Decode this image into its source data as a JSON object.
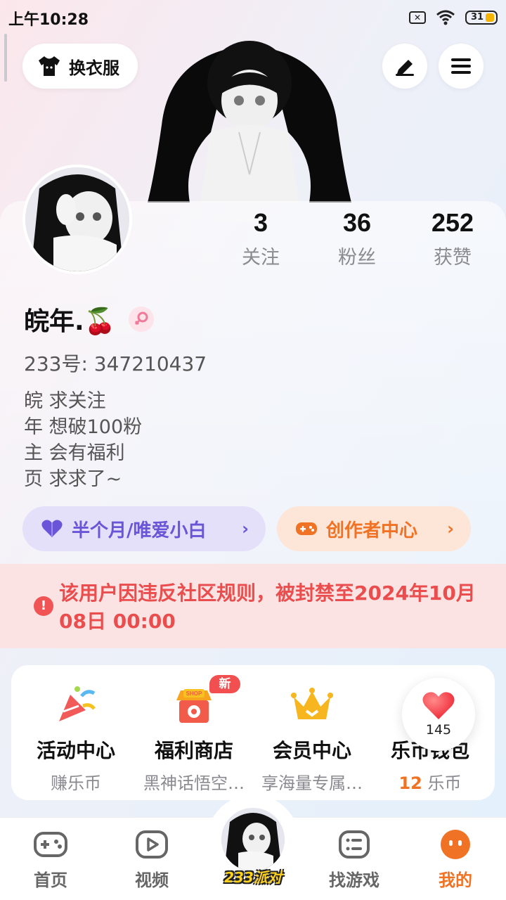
{
  "status_bar": {
    "time": "上午10:28",
    "sim_icon": "sim-off-icon",
    "wifi_icon": "wifi-icon",
    "battery": "31"
  },
  "top_bar": {
    "dress_label": "换衣服",
    "edit_icon": "edit-icon",
    "menu_icon": "menu-icon"
  },
  "profile": {
    "stats": [
      {
        "value": "3",
        "label": "关注"
      },
      {
        "value": "36",
        "label": "粉丝"
      },
      {
        "value": "252",
        "label": "获赞"
      }
    ],
    "nickname": "皖年.🍒",
    "gender_icon": "female-icon",
    "uid": "233号: 347210437",
    "bio": [
      "皖 求关注",
      "年 想破100粉",
      "主 会有福利",
      "页 求求了~"
    ],
    "chips": [
      {
        "label": "半个月/唯爱小白",
        "icon": "heart-icon",
        "color": "#6a55d8"
      },
      {
        "label": "创作者中心",
        "icon": "gamepad-icon",
        "color": "#f07325"
      }
    ]
  },
  "ban_notice": {
    "text": "该用户因违反社区规则，被封禁至2024年10月08日 00:00",
    "color": "#ea4d4d"
  },
  "features": [
    {
      "title": "活动中心",
      "subtitle": "赚乐币",
      "icon": "party-popper-icon"
    },
    {
      "title": "福利商店",
      "subtitle": "黑神话悟空…",
      "icon": "shop-icon",
      "badge": "新"
    },
    {
      "title": "会员中心",
      "subtitle": "享海量专属…",
      "icon": "crown-icon"
    },
    {
      "title": "乐币钱包",
      "subtitle_value": "12",
      "subtitle_unit": " 乐币",
      "icon": "wallet-icon"
    }
  ],
  "like_bubble": {
    "count": "145",
    "icon": "heart-icon"
  },
  "bottom_nav": {
    "items": [
      {
        "label": "首页",
        "icon": "gamepad-icon"
      },
      {
        "label": "视频",
        "icon": "play-icon"
      },
      {
        "label": "233派对",
        "icon": "party-avatar-icon"
      },
      {
        "label": "找游戏",
        "icon": "list-icon"
      },
      {
        "label": "我的",
        "icon": "smile-icon",
        "active": true
      }
    ]
  },
  "colors": {
    "accent": "#f07325",
    "purple": "#6a55d8",
    "danger": "#ea4d4d"
  }
}
